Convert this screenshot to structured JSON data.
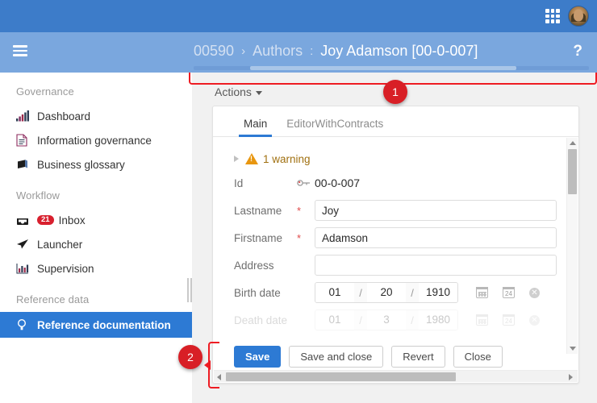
{
  "topbar": {
    "apps_icon": "grid-apps-icon",
    "avatar_icon": "user-avatar"
  },
  "breadcrumb": {
    "menu_icon": "hamburger-menu-icon",
    "truncated_id": "00590",
    "separator": "›",
    "entity": "Authors",
    "colon": ":",
    "current": "Joy Adamson [00-0-007]",
    "help_label": "?"
  },
  "sidebar": {
    "groups": [
      {
        "title": "Governance",
        "items": [
          {
            "label": "Dashboard",
            "icon": "bar-chart-icon"
          },
          {
            "label": "Information governance",
            "icon": "document-icon"
          },
          {
            "label": "Business glossary",
            "icon": "book-icon"
          }
        ]
      },
      {
        "title": "Workflow",
        "items": [
          {
            "label": "Inbox",
            "icon": "inbox-tray-icon",
            "badge": "21"
          },
          {
            "label": "Launcher",
            "icon": "paper-plane-icon"
          },
          {
            "label": "Supervision",
            "icon": "bar-chart-icon"
          }
        ]
      },
      {
        "title": "Reference data",
        "items": [
          {
            "label": "Reference documentation",
            "icon": "lightbulb-icon",
            "selected": true
          }
        ]
      }
    ]
  },
  "main": {
    "actions_label": "Actions",
    "tabs": [
      {
        "label": "Main",
        "active": true
      },
      {
        "label": "EditorWithContracts",
        "active": false
      }
    ],
    "warning": {
      "expand_icon": "triangle-right-icon",
      "warn_icon": "warning-triangle-icon",
      "text": "1 warning"
    },
    "fields": [
      {
        "name": "id",
        "label": "Id",
        "value": "00-0-007",
        "type": "readonly",
        "icon": "primary-key-icon"
      },
      {
        "name": "lastname",
        "label": "Lastname",
        "value": "Joy",
        "type": "text",
        "required": "*"
      },
      {
        "name": "firstname",
        "label": "Firstname",
        "value": "Adamson",
        "type": "text",
        "required": "*"
      },
      {
        "name": "address",
        "label": "Address",
        "value": "",
        "type": "text",
        "placeholder": ""
      }
    ],
    "birth_date": {
      "label": "Birth date",
      "month": "01",
      "day": "20",
      "year": "1910",
      "slash": "/",
      "calendar_icon": "calendar-icon",
      "calendar_day_icon": "calendar-24-icon",
      "clear_icon": "clear-circle-icon",
      "clear_glyph": "✕"
    },
    "death_date": {
      "label": "Death date",
      "month": "01",
      "day": "3",
      "year": "1980",
      "slash": "/"
    },
    "buttons": [
      {
        "label": "Save",
        "style": "primary"
      },
      {
        "label": "Save and close",
        "style": "default"
      },
      {
        "label": "Revert",
        "style": "default"
      },
      {
        "label": "Close",
        "style": "default"
      }
    ]
  },
  "annotations": [
    {
      "id": "1",
      "label": "1"
    },
    {
      "id": "2",
      "label": "2"
    }
  ],
  "colors": {
    "topbar_blue": "#3d7cc9",
    "crumb_blue": "#7aa7de",
    "accent_blue": "#2d7ad4",
    "badge_red": "#d8202e",
    "annotation_red": "#d81f26",
    "warning_orange": "#e8960f",
    "required_red": "#e04a4a"
  }
}
